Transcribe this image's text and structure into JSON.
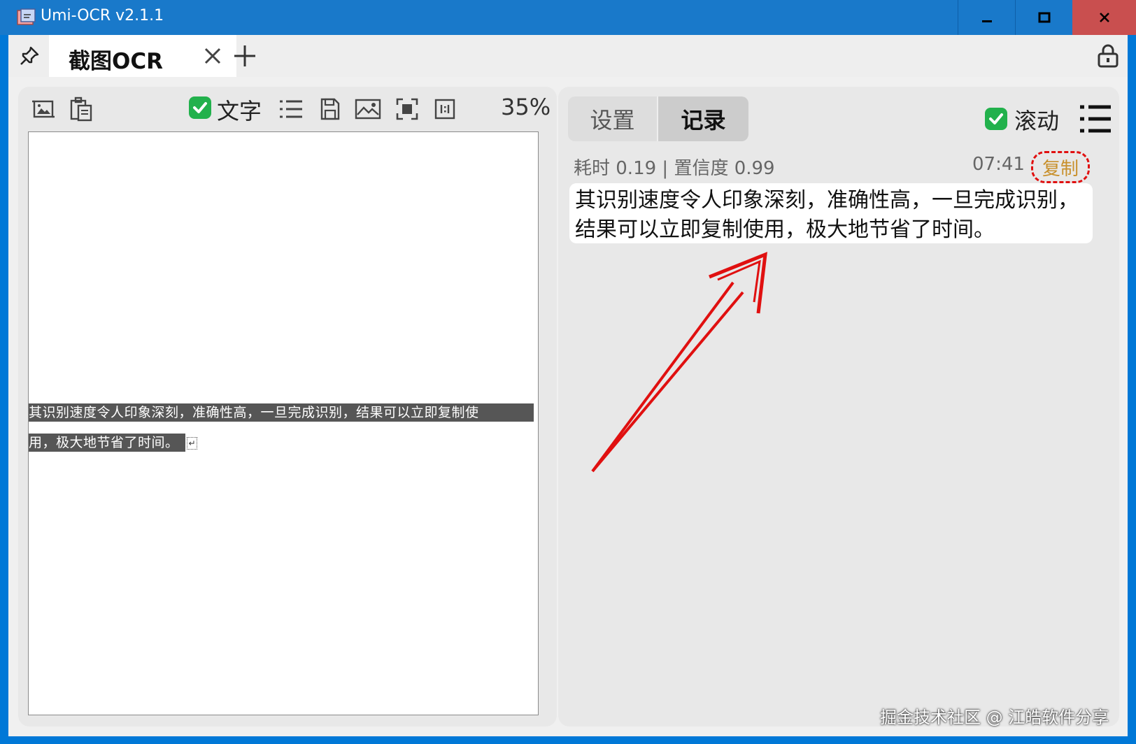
{
  "window": {
    "title": "Umi-OCR v2.1.1"
  },
  "tabs": [
    {
      "label": "截图OCR",
      "active": true
    }
  ],
  "left_toolbar": {
    "text_check_label": "文字",
    "text_checked": true,
    "zoom": "35%"
  },
  "canvas": {
    "line1": "其识别速度令人印象深刻，准确性高，一旦完成识别，结果可以立即复制使",
    "line2": "用，极大地节省了时间。",
    "return_mark": "↵"
  },
  "right_panel": {
    "tabs": [
      "设置",
      "记录"
    ],
    "active_tab": "记录",
    "scroll_label": "滚动",
    "scroll_checked": true
  },
  "record": {
    "meta": "耗时 0.19 | 置信度 0.99",
    "time": "07:41",
    "copy_label": "复制",
    "text": "其识别速度令人印象深刻，准确性高，一旦完成识别，结果可以立即复制使用，极大地节省了时间。"
  },
  "watermark": "掘金技术社区 @ 江皓软件分享",
  "colors": {
    "titlebar": "#1979ca",
    "close_button": "#c94f4f",
    "check_green": "#22b14c",
    "copy_text": "#c8902c",
    "annotation_red": "#e01010"
  }
}
